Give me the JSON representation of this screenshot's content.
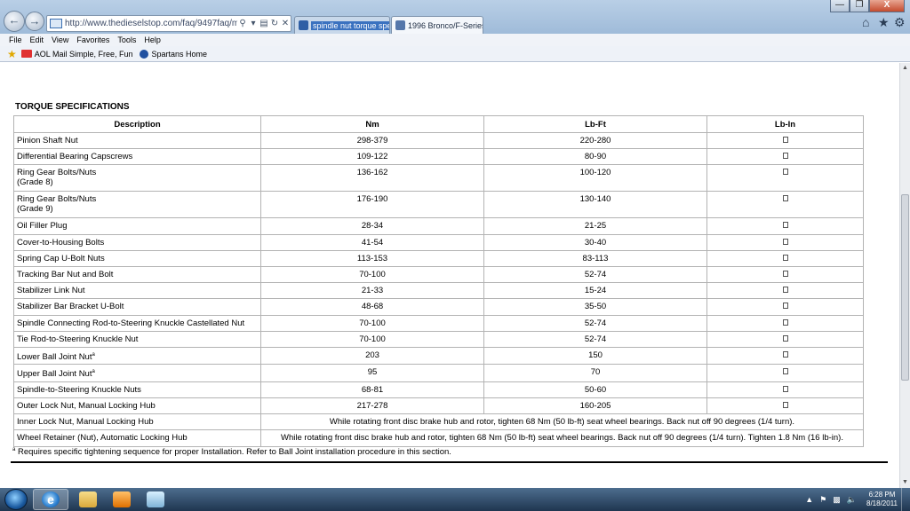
{
  "browser": {
    "address": "http://www.thedieselstop.com/faq/9497faq/maint/stj/s",
    "tabs": [
      {
        "label": "spindle nut torque spec..."
      },
      {
        "label": "1996 Bronco/F-Series"
      }
    ],
    "window_buttons": {
      "minimize": "—",
      "maximize": "❐",
      "close": "X"
    }
  },
  "menu": [
    "File",
    "Edit",
    "View",
    "Favorites",
    "Tools",
    "Help"
  ],
  "favorites": [
    "AOL Mail Simple, Free, Fun",
    "Spartans Home"
  ],
  "spec": {
    "title": "TORQUE SPECIFICATIONS",
    "headers": [
      "Description",
      "Nm",
      "Lb-Ft",
      "Lb-In"
    ],
    "rows": [
      {
        "desc": "Pinion Shaft Nut",
        "nm": "298-379",
        "lbft": "220-280"
      },
      {
        "desc": "Differential Bearing Capscrews",
        "nm": "109-122",
        "lbft": "80-90"
      },
      {
        "desc": "Ring Gear Bolts/Nuts",
        "desc2": "(Grade 8)",
        "nm": "136-162",
        "lbft": "100-120"
      },
      {
        "desc": "Ring Gear Bolts/Nuts",
        "desc2": "(Grade 9)",
        "nm": "176-190",
        "lbft": "130-140"
      },
      {
        "desc": "Oil Filler Plug",
        "nm": "28-34",
        "lbft": "21-25"
      },
      {
        "desc": "Cover-to-Housing Bolts",
        "nm": "41-54",
        "lbft": "30-40"
      },
      {
        "desc": "Spring Cap U-Bolt Nuts",
        "nm": "113-153",
        "lbft": "83-113"
      },
      {
        "desc": "Tracking Bar Nut and Bolt",
        "nm": "70-100",
        "lbft": "52-74"
      },
      {
        "desc": "Stabilizer Link Nut",
        "nm": "21-33",
        "lbft": "15-24"
      },
      {
        "desc": "Stabilizer Bar Bracket U-Bolt",
        "nm": "48-68",
        "lbft": "35-50"
      },
      {
        "desc": "Spindle Connecting Rod-to-Steering Knuckle Castellated Nut",
        "nm": "70-100",
        "lbft": "52-74"
      },
      {
        "desc": "Tie Rod-to-Steering Knuckle Nut",
        "nm": "70-100",
        "lbft": "52-74"
      },
      {
        "desc": "Lower Ball Joint Nut",
        "sup": "a",
        "nm": "203",
        "lbft": "150"
      },
      {
        "desc": "Upper Ball Joint Nut",
        "sup": "a",
        "nm": "95",
        "lbft": "70"
      },
      {
        "desc": "Spindle-to-Steering Knuckle Nuts",
        "nm": "68-81",
        "lbft": "50-60"
      },
      {
        "desc": "Outer Lock Nut, Manual Locking Hub",
        "nm": "217-278",
        "lbft": "160-205"
      },
      {
        "desc": "Inner Lock Nut, Manual Locking Hub",
        "span": "While rotating front disc brake hub and rotor, tighten 68 Nm (50 lb-ft) seat wheel bearings. Back nut off 90 degrees (1/4 turn)."
      },
      {
        "desc": "Wheel Retainer (Nut), Automatic Locking Hub",
        "span": "While rotating front disc brake hub and rotor, tighten 68 Nm (50 lb-ft) seat wheel bearings. Back nut off 90 degrees (1/4 turn). Tighten 1.8 Nm (16 lb-in)."
      }
    ],
    "footnote_mark": "a",
    "footnote": "Requires specific tightening sequence for proper Installation. Refer to Ball Joint installation procedure in this section."
  },
  "taskbar": {
    "time": "6:28 PM",
    "date": "8/18/2011"
  }
}
